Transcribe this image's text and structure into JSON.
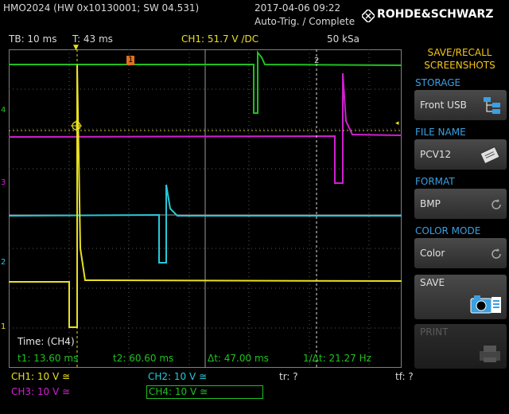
{
  "header": {
    "device": "HMO2024 (HW 0x10130001; SW 04.531)",
    "datetime": "2017-04-06 09:22",
    "trigger_status": "Auto-Trig. / Complete",
    "brand": "ROHDE&SCHWARZ"
  },
  "status_bar": {
    "timebase": "TB: 10 ms",
    "trigger_time": "T: 43 ms",
    "trigger_info": "CH1: 51.7 V ∕DC",
    "sample_rate": "50 kSa"
  },
  "markers": {
    "trigger_marker": "T",
    "cursor1": "1",
    "cursor2": "2",
    "ch4_marker": "4",
    "ch3_marker": "3",
    "ch2_marker": "2",
    "ch1_marker": "1"
  },
  "measurement": {
    "title": "Time: (CH4)",
    "t1": "t1: 13.60 ms",
    "t2": "t2: 60.60 ms",
    "dt": "Δt: 47.00 ms",
    "inv_dt": "1/Δt: 21.27 Hz"
  },
  "channels": {
    "ch1": "CH1: 10 V ≅",
    "ch2": "CH2: 10 V ≅",
    "ch3": "CH3: 10 V ≅",
    "ch4": "CH4: 10 V ≅",
    "tr": "tr: ?",
    "tf": "tf: ?"
  },
  "menu": {
    "title": "SAVE/RECALL SCREENSHOTS",
    "storage_label": "STORAGE",
    "storage_value": "Front USB",
    "filename_label": "FILE NAME",
    "filename_value": "PCV12",
    "format_label": "FORMAT",
    "format_value": "BMP",
    "colormode_label": "COLOR MODE",
    "colormode_value": "Color",
    "save_label": "SAVE",
    "print_label": "PRINT"
  },
  "colors": {
    "ch1": "#e8e020",
    "ch2": "#28c8d8",
    "ch3": "#d020d0",
    "ch4": "#20c020",
    "accent_yellow": "#f5c518",
    "menu_blue": "#3aa0e0"
  }
}
